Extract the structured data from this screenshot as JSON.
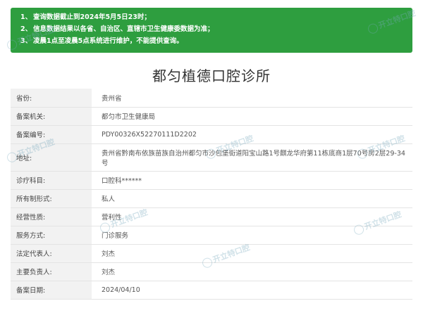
{
  "notice": {
    "items": [
      {
        "num": "1、",
        "text": "查询数据截止到2024年5月5日23时；"
      },
      {
        "num": "2、",
        "text": "信息数据结果以各省、自治区、直辖市卫生健康委数据为准；"
      },
      {
        "num": "3、",
        "text": "凌晨1点至凌晨5点系统进行维护，不能提供查询。"
      }
    ]
  },
  "title": "都匀植德口腔诊所",
  "rows": [
    {
      "label": "省份:",
      "value": "贵州省"
    },
    {
      "label": "备案机关:",
      "value": "都匀市卫生健康局"
    },
    {
      "label": "备案编号:",
      "value": "PDY00326X52270111D2202"
    },
    {
      "label": "地址:",
      "value": "贵州省黔南布依族苗族自治州都匀市沙包堡街道阳宝山路1号麒龙华府第11栋底商1层70号房2层29-34号"
    },
    {
      "label": "诊疗科目:",
      "value": "口腔科******"
    },
    {
      "label": "所有制形式:",
      "value": "私人"
    },
    {
      "label": "经营性质:",
      "value": "营利性"
    },
    {
      "label": "服务方式:",
      "value": "门诊服务"
    },
    {
      "label": "法定代表人:",
      "value": "刘杰"
    },
    {
      "label": "主要负责人:",
      "value": "刘杰"
    },
    {
      "label": "备案日期:",
      "value": "2024/04/10"
    }
  ],
  "watermark": "开立特口腔"
}
